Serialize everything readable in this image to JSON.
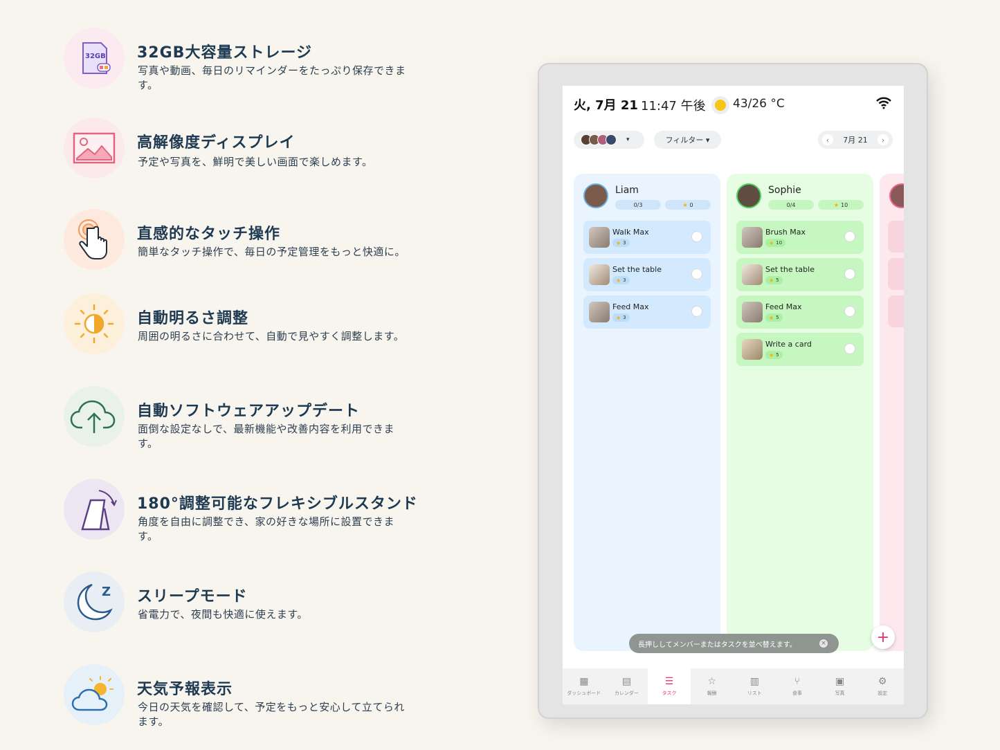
{
  "features": [
    {
      "icon": "sd-card-icon",
      "title": "32GB大容量ストレージ",
      "desc": "写真や動画、毎日のリマインダーをたっぷり保存できます。",
      "badge": "32GB"
    },
    {
      "icon": "image-icon",
      "title": "高解像度ディスプレイ",
      "desc": "予定や写真を、鮮明で美しい画面で楽しめます。"
    },
    {
      "icon": "touch-hand-icon",
      "title": "直感的なタッチ操作",
      "desc": "簡単なタッチ操作で、毎日の予定管理をもっと快適に。"
    },
    {
      "icon": "brightness-icon",
      "title": "自動明るさ調整",
      "desc": "周囲の明るさに合わせて、自動で見やすく調整します。"
    },
    {
      "icon": "cloud-upload-icon",
      "title": "自動ソフトウェアアップデート",
      "desc": "面倒な設定なしで、最新機能や改善内容を利用できます。"
    },
    {
      "icon": "stand-icon",
      "title": "180°調整可能なフレキシブルスタンド",
      "desc": "角度を自由に調整でき、家の好きな場所に設置できます。"
    },
    {
      "icon": "moon-icon",
      "title": "スリープモード",
      "desc": "省電力で、夜間も快適に使えます。",
      "badge": "Z"
    },
    {
      "icon": "weather-icon",
      "title": "天気予報表示",
      "desc": "今日の天気を確認して、予定をもっと安心して立てられます。"
    }
  ],
  "device": {
    "date": "火, 7月 21",
    "time": "11:47 午後",
    "weather_icon": "sun-icon",
    "temperature": "43/26 °C",
    "filter_label": "フィルター ▾",
    "nav_date": "7月 21",
    "nav_prev": "‹",
    "nav_next": "›",
    "members_caret": "▾",
    "columns": [
      {
        "name": "Liam",
        "progress": "0/3",
        "points": "0",
        "tasks": [
          {
            "name": "Walk Max",
            "points": "3"
          },
          {
            "name": "Set the table",
            "points": "3"
          },
          {
            "name": "Feed Max",
            "points": "3"
          }
        ]
      },
      {
        "name": "Sophie",
        "progress": "0/4",
        "points": "10",
        "tasks": [
          {
            "name": "Brush Max",
            "points": "10"
          },
          {
            "name": "Set the table",
            "points": "5"
          },
          {
            "name": "Feed Max",
            "points": "5"
          },
          {
            "name": "Write a card",
            "points": "5"
          }
        ]
      }
    ],
    "toast": "長押ししてメンバーまたはタスクを並べ替えます。",
    "toast_close": "×",
    "fab": "+",
    "bottom_nav": [
      {
        "label": "ダッシュボード",
        "icon": "dashboard-icon",
        "glyph": "▦"
      },
      {
        "label": "カレンダー",
        "icon": "calendar-icon",
        "glyph": "▤"
      },
      {
        "label": "タスク",
        "icon": "tasks-icon",
        "glyph": "☰",
        "active": true
      },
      {
        "label": "報酬",
        "icon": "star-icon",
        "glyph": "☆"
      },
      {
        "label": "リスト",
        "icon": "list-icon",
        "glyph": "▥"
      },
      {
        "label": "食事",
        "icon": "utensils-icon",
        "glyph": "⑂"
      },
      {
        "label": "写真",
        "icon": "photo-icon",
        "glyph": "▣"
      },
      {
        "label": "設定",
        "icon": "settings-icon",
        "glyph": "⚙"
      }
    ],
    "colors": {
      "accent": "#e5356a",
      "liam": "#eaf4fe",
      "sophie": "#e6fde4",
      "third": "#fde8ee"
    }
  }
}
